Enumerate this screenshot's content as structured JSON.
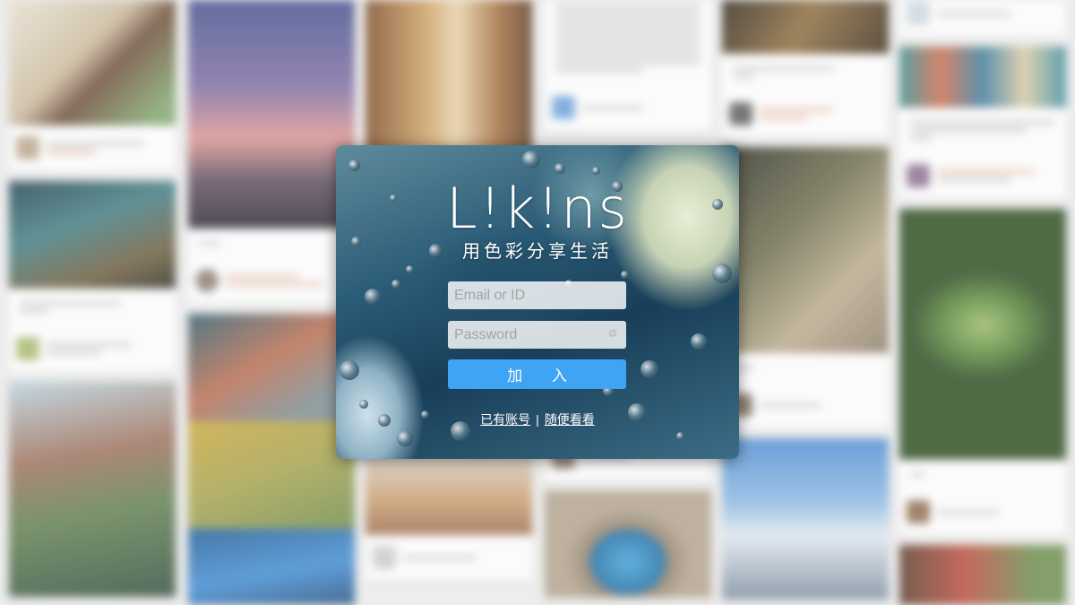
{
  "login": {
    "logo_text": "L!k!ns",
    "slogan": "用色彩分享生活",
    "email_placeholder": "Email or ID",
    "password_placeholder": "Password",
    "submit_label": "加 入",
    "existing_account_link": "已有账号",
    "separator": "|",
    "browse_link": "随便看看"
  },
  "colors": {
    "submit_button": "#3fa4f3",
    "text": "#ffffff"
  }
}
